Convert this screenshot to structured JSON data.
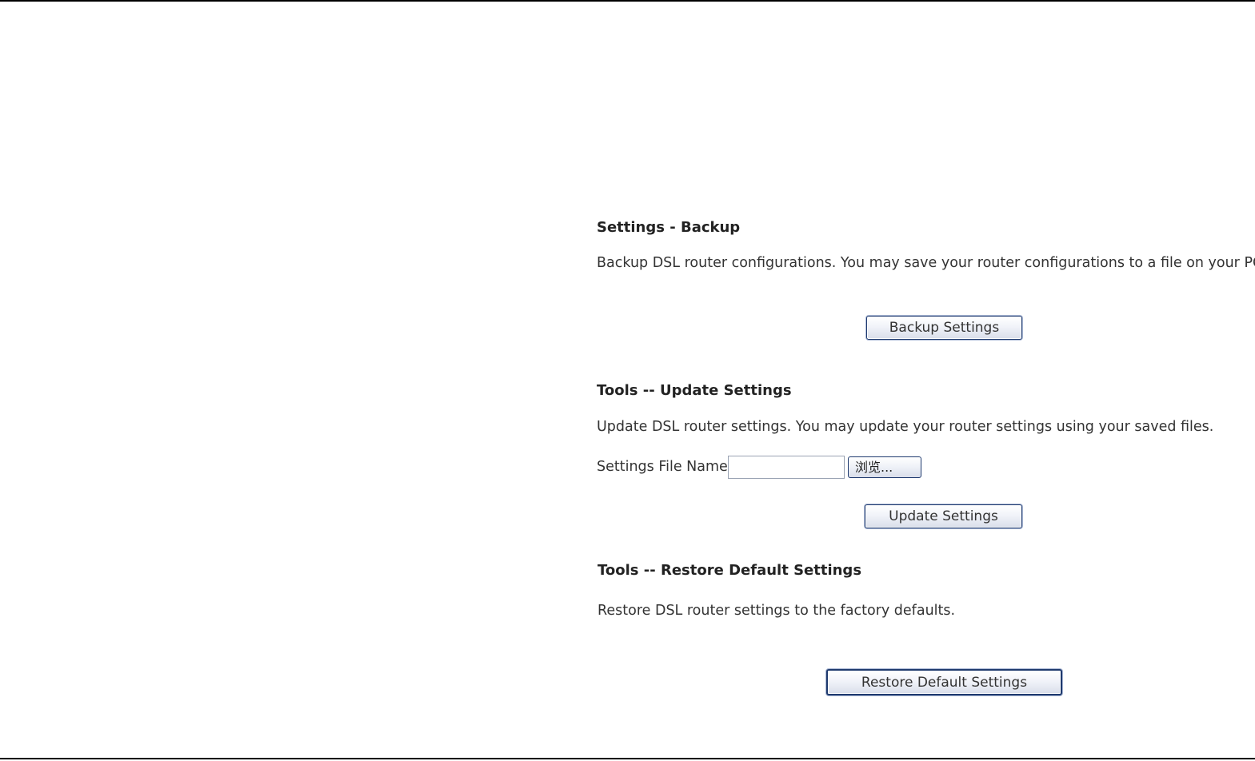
{
  "backup": {
    "title": "Settings - Backup",
    "description": "Backup DSL router configurations. You may save your router configurations to a file on your PC.",
    "button_label": "Backup Settings"
  },
  "update": {
    "title": "Tools -- Update Settings",
    "description": "Update DSL router settings. You may update your router settings using your saved files.",
    "file_label": "Settings File Name:",
    "file_value": "",
    "browse_label": "浏览...",
    "button_label": "Update Settings"
  },
  "restore": {
    "title": "Tools -- Restore Default Settings",
    "description": "Restore DSL router settings to the factory defaults.",
    "button_label": "Restore Default Settings"
  }
}
